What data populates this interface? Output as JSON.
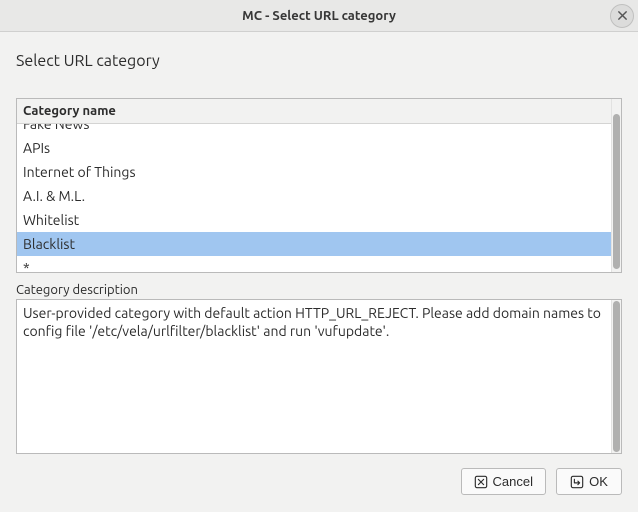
{
  "window": {
    "title": "MC - Select URL category"
  },
  "page": {
    "title": "Select URL category"
  },
  "list": {
    "header": "Category name",
    "items": [
      {
        "label": "Fake News",
        "selected": false,
        "partial": true
      },
      {
        "label": "APIs",
        "selected": false,
        "partial": false
      },
      {
        "label": "Internet of Things",
        "selected": false,
        "partial": false
      },
      {
        "label": "A.I. & M.L.",
        "selected": false,
        "partial": false
      },
      {
        "label": "Whitelist",
        "selected": false,
        "partial": false
      },
      {
        "label": "Blacklist",
        "selected": true,
        "partial": false
      },
      {
        "label": "*",
        "selected": false,
        "partial": false
      }
    ]
  },
  "description": {
    "label": "Category description",
    "text": "User-provided category with default action HTTP_URL_REJECT. Please add domain names to config file '/etc/vela/urlfilter/blacklist' and run 'vufupdate'."
  },
  "buttons": {
    "cancel": "Cancel",
    "ok": "OK"
  }
}
